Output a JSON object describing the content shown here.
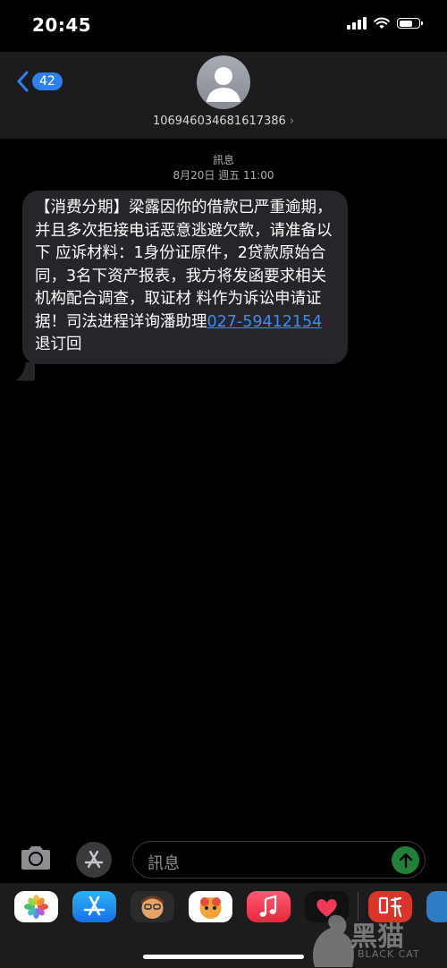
{
  "status_bar": {
    "time": "20:45"
  },
  "header": {
    "back_count": "42",
    "contact_number": "106946034681617386",
    "chevron": "›"
  },
  "thread": {
    "service_label": "訊息",
    "timestamp": "8月20日 週五 11:00"
  },
  "message": {
    "text": "【消费分期】梁露因你的借款已严重逾期，并且多次拒接电话恶意逃避欠款，请准备以下 应诉材料：1身份证原件，2贷款原始合同，3名下资产报表，我方将发函要求相关机构配合调查，取证材 料作为诉讼申请证据！司法进程详询潘助理",
    "phone": "027-59412154",
    "suffix": "退订回"
  },
  "compose": {
    "placeholder": "訊息"
  },
  "app_drawer": {
    "icons": [
      "photos-icon",
      "app-store-icon",
      "memoji-icon",
      "animoji-icon",
      "music-icon",
      "digital-touch-icon",
      "listen-app-icon",
      "extra-app-icon"
    ]
  },
  "watermark": {
    "text": "黑猫",
    "sub": "BLACK CAT"
  },
  "colors": {
    "accent": "#2f80ec",
    "link": "#3b8cf5",
    "bubble": "#26262a",
    "send": "#23803a"
  }
}
